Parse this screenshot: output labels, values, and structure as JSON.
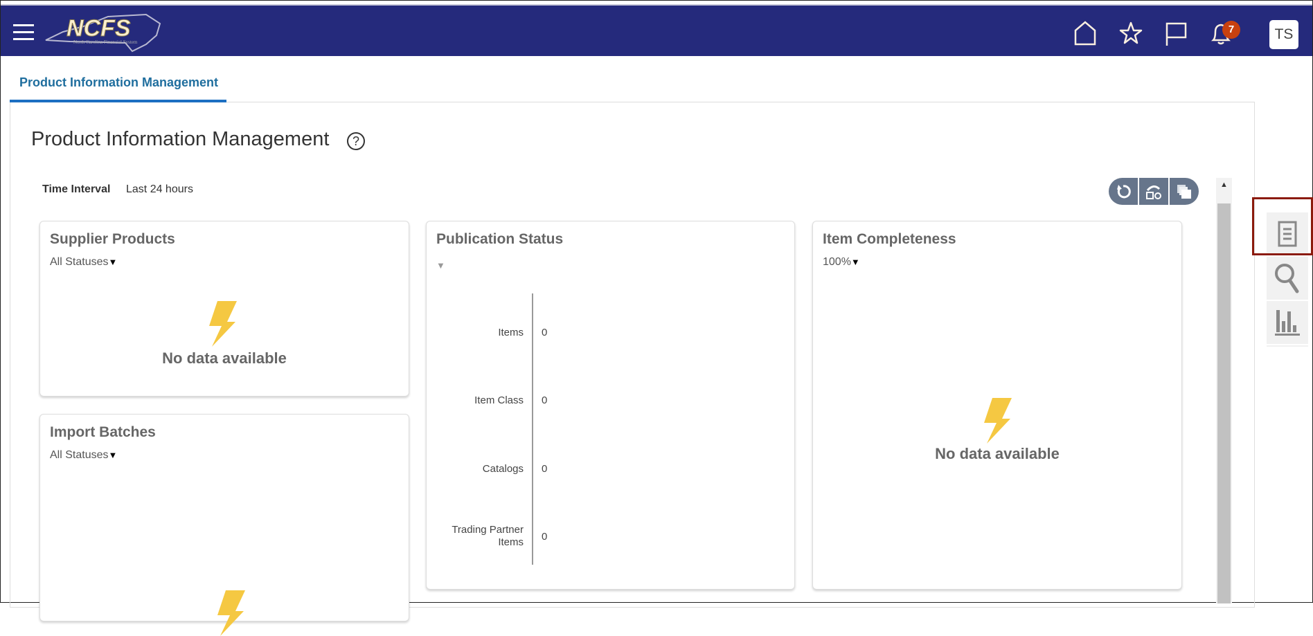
{
  "header": {
    "logo_text": "NCFS",
    "logo_subtitle": "North Carolina Financial System",
    "notification_count": "7",
    "user_initials": "TS",
    "icons": [
      "hamburger-menu-icon",
      "home-icon",
      "star-icon",
      "flag-icon",
      "bell-icon"
    ]
  },
  "tab": {
    "label": "Product Information Management"
  },
  "page": {
    "title": "Product Information Management",
    "help": "?"
  },
  "time_interval": {
    "label": "Time Interval",
    "value": "Last 24 hours"
  },
  "toolbar": {
    "icons": [
      "refresh-icon",
      "personalize-icon",
      "detach-icon"
    ]
  },
  "cards": {
    "supplier_products": {
      "title": "Supplier Products",
      "filter": "All Statuses",
      "empty": "No data available"
    },
    "import_batches": {
      "title": "Import Batches",
      "filter": "All Statuses"
    },
    "publication_status": {
      "title": "Publication Status",
      "rows": [
        {
          "label": "Items",
          "value": "0"
        },
        {
          "label": "Item Class",
          "value": "0"
        },
        {
          "label": "Catalogs",
          "value": "0"
        },
        {
          "label": "Trading Partner Items",
          "value": "0"
        }
      ]
    },
    "item_completeness": {
      "title": "Item Completeness",
      "filter": "100%",
      "empty": "No data available"
    }
  },
  "dropdown_glyph": "▼",
  "scroll_up_glyph": "▲",
  "rail": {
    "icons": [
      "document-icon",
      "search-icon",
      "bar-chart-icon"
    ]
  },
  "colors": {
    "header": "#252a7c",
    "accent": "#1c6fc2",
    "badge": "#c8410f",
    "bolt": "#f5c842",
    "highlight": "#8b1a0c"
  }
}
